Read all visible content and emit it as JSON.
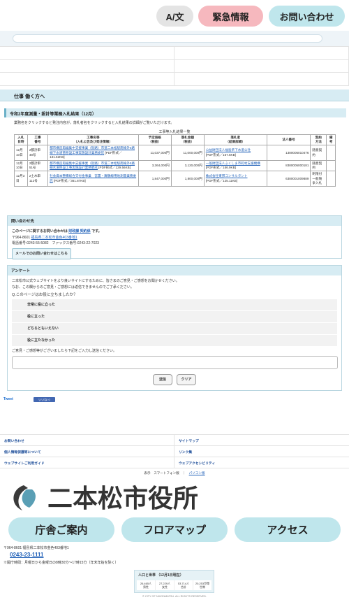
{
  "header": {
    "lang_label": "A/文",
    "emergency_label": "緊急情報",
    "inquiry_label": "お問い合わせ"
  },
  "category": "仕事 働く方へ",
  "page": {
    "title": "令和2年度測量・設計等業務入札結果（12月）",
    "intro": "業務名をクリックすると発注内容が，落札者名をクリックすると入札結果の詳細がご覧いただけます。",
    "caption": "工事等入札結果一覧"
  },
  "table": {
    "headers": [
      "入札\n日時",
      "工事\n番号",
      "工事名等\n（入札公告及び発注情報）",
      "予定価格\n（税抜）",
      "落札金額\n（税抜）",
      "落札者\n（結果詳細）",
      "法人番号",
      "契約\n方法",
      "備\n考"
    ],
    "rows": [
      {
        "date": "12月\n10日",
        "no": "2都計単\n48号",
        "name_link": "都市構造再編集中支援事業（街路）市道二本松駅南線外5路線下水道管移設工事実施設計業務委託",
        "name_tail": " [PDF形式／131.52KB]",
        "planned": "11,037,000円",
        "winning": "11,000,000円",
        "winner_link": "公益財団法人福島県下水道公社",
        "winner_tail": "[PDF形式／157.5KB]",
        "corp_no": "1380005010476",
        "method": "随意契約",
        "note": ""
      },
      {
        "date": "12月\n10日",
        "no": "2都計単\n51号",
        "name_link": "都市構造再編集中支援事業（街路）市道二本松駅南線外5路線水道移設工事実施設計業務委託",
        "name_tail": " [PDF形式／129.56KB]",
        "planned": "3,364,000円",
        "winning": "3,120,000円",
        "winner_link": "一般財団法人ふくしま市町村支援機構",
        "winner_tail": "[PDF形式／156.9KB]",
        "corp_no": "8380005000181",
        "method": "随意契約",
        "note": ""
      },
      {
        "date": "12月3\n日",
        "no": "2土木単\n112号",
        "name_link": "社会資本整備総合交付金事業　宮置・舞鶴線用地測量業務委託",
        "name_tail": " [PDF形式／361.87KB]",
        "planned": "1,847,000円",
        "winning": "1,800,000円",
        "winner_link": "株式会社東邦コンサルタント",
        "winner_tail": "[PDF形式／125.11KB]",
        "corp_no": "6380001009889",
        "method": "制限付一般競争入札",
        "note": ""
      }
    ]
  },
  "inquiry": {
    "heading": "問い合わせ先",
    "lead_pre": "このページに関するお問い合わせは ",
    "dept": "財政課 契約係",
    "lead_post": " です。",
    "postal": "〒964-8601 ",
    "address_link": "福島県二本松市金色403番地1",
    "phone_fax": "電話番号:0243-55-5082　ファックス番号:0243-22-7023",
    "mail_button": "メールでのお問い合わせはこちら"
  },
  "survey": {
    "heading": "アンケート",
    "intro1": "二本松市公式ウェブサイトをより良いサイトにするために、皆さまのご意見・ご感想をお聞かせください。",
    "intro2": "なお、この欄からのご意見・ご感想には返信できませんのでご了承ください。",
    "question": "Q.このページはお役に立ちましたか？",
    "options": [
      "非常に役に立った",
      "役に立った",
      "どちらともいえない",
      "役に立たなかった"
    ],
    "comment_label": "ご意見・ご感想等がございましたら下記をご入力し送信ください。",
    "submit": "送信",
    "clear": "クリア"
  },
  "social": {
    "tweet": "Tweet",
    "fb": "いいね! 0"
  },
  "footer_nav": [
    [
      "お問い合わせ",
      "サイトマップ"
    ],
    [
      "個人情報保護等について",
      "リンク集"
    ],
    [
      "ウェブサイトご利用ガイド",
      "ウェブアクセシビリティ"
    ]
  ],
  "view_switch": {
    "prefix": "表示　スマートフォン版　｜　",
    "pc": "パソコン版"
  },
  "logo_text": "二本松市役所",
  "big_buttons": [
    "庁舎ご案内",
    "フロアマップ",
    "アクセス"
  ],
  "contact": {
    "address": "〒964-8601 福島県二本松市金色403番地1",
    "phone": "0243-23-1111",
    "hours": "※開庁時間：月曜日から金曜日の8時30分〜17時15分（年末年始を除く）"
  },
  "population": {
    "heading": "人口と世帯 （12月1日現在）",
    "cells": [
      {
        "value": "26,465人",
        "label": "男性"
      },
      {
        "value": "27,229人",
        "label": "女性"
      },
      {
        "value": "53,714人",
        "label": "合計"
      },
      {
        "value": "20,253世帯",
        "label": "世帯"
      }
    ]
  },
  "copyright": "© CITY OF NIHONMATSU. ALL RIGHTS RESERVED.",
  "colors": {
    "accent_blue": "#bfe6ec",
    "emergency_pink": "#f6b8be",
    "link": "#1f60b8"
  }
}
